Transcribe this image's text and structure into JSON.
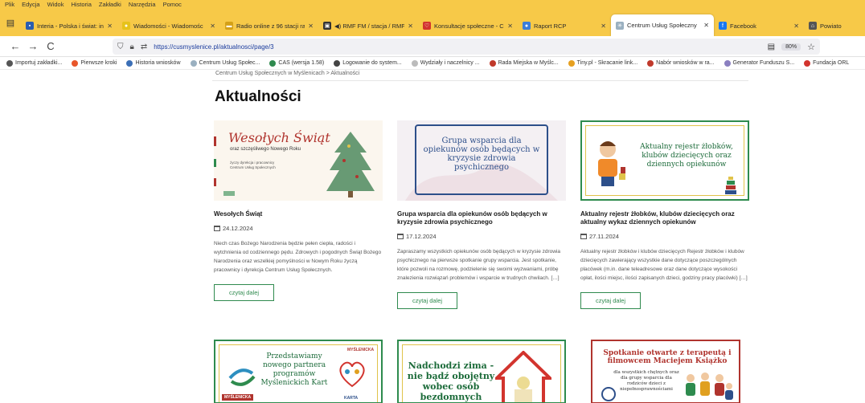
{
  "menu": [
    "Plik",
    "Edycja",
    "Widok",
    "Historia",
    "Zakładki",
    "Narzędzia",
    "Pomoc"
  ],
  "tabs": [
    {
      "title": "Interia - Polska i świat: info",
      "fav_color": "#2a5db0",
      "fav_glyph": "▪",
      "active": false
    },
    {
      "title": "Wiadomości - Wiadomośc",
      "fav_color": "#e6c21a",
      "fav_glyph": "●",
      "active": false
    },
    {
      "title": "Radio online z 96 stacji rad",
      "fav_color": "#d4a017",
      "fav_glyph": "▬",
      "active": false
    },
    {
      "title": "◀) RMF FM / stacja / RMF",
      "fav_color": "#333333",
      "fav_glyph": "▣",
      "active": false
    },
    {
      "title": "Konsultacje społeczne - Cl",
      "fav_color": "#d2342e",
      "fav_glyph": "♡",
      "active": false
    },
    {
      "title": "Raport RCP",
      "fav_color": "#3b7dd8",
      "fav_glyph": "●",
      "active": false
    },
    {
      "title": "Centrum Usług Społeczny",
      "fav_color": "#9ab0c0",
      "fav_glyph": "✳",
      "active": true
    },
    {
      "title": "Facebook",
      "fav_color": "#1877f2",
      "fav_glyph": "f",
      "active": false
    },
    {
      "title": "Powiato",
      "fav_color": "#555555",
      "fav_glyph": "⌂",
      "active": false
    }
  ],
  "nav": {
    "url": "https://cusmyslenice.pl/aktualnosci/page/3",
    "zoom": "80%"
  },
  "bookmarks": [
    {
      "label": "Importuj zakładki...",
      "color": "#555555"
    },
    {
      "label": "Pierwsze kroki",
      "color": "#e8562a"
    },
    {
      "label": "Historia wniosków",
      "color": "#3b6fb6"
    },
    {
      "label": "Centrum Usług Społec...",
      "color": "#9ab0c0"
    },
    {
      "label": "CAS (wersja 1.58)",
      "color": "#2f8a4e"
    },
    {
      "label": "Logowanie do system...",
      "color": "#444444"
    },
    {
      "label": "Wydziały i naczelnicy ...",
      "color": "#bbbbbb"
    },
    {
      "label": "Rada Miejska w Myślc...",
      "color": "#c0392b"
    },
    {
      "label": "Tiny.pl - Skracanie link...",
      "color": "#e6a020"
    },
    {
      "label": "Nabór wniosków w ra...",
      "color": "#c0392b"
    },
    {
      "label": "Generator Funduszu S...",
      "color": "#8a7fc0"
    },
    {
      "label": "Fundacja ORL",
      "color": "#d2342e"
    }
  ],
  "page": {
    "breadcrumb": "Centrum Usług Społecznych w Myślenicach > Aktualności",
    "title": "Aktualności",
    "read_more": "czytaj dalej"
  },
  "cards": [
    {
      "title": "Wesołych Świąt",
      "date": "24.12.2024",
      "text": "Niech czas Bożego Narodzenia będzie pełen ciepła, radości i wytchnienia od codziennego pędu. Zdrowych i pogodnych Świąt Bożego Narodzenia oraz wszelkiej pomyślności w Nowym Roku życzą pracownicy i dyrekcja Centrum Usług Społecznych.",
      "thumb": {
        "line1": "Wesołych Świąt",
        "line2": "oraz szczęśliwego Nowego Roku",
        "line3": "życzy dyrekcja i pracownicy Centrum Usług Społecznych"
      }
    },
    {
      "title": "Grupa wsparcia dla opiekunów osób będących w kryzysie zdrowia psychicznego",
      "date": "17.12.2024",
      "text": "Zapraszamy wszystkich opiekunów osób będących w kryzysie zdrowia psychicznego na pierwsze spotkanie grupy wsparcia. Jest spotkanie, które pozwoli na rozmowę, podzielenie się swoimi wyzwaniami, próbę znalezienia rozwiązań problemów i wsparcie w trudnych chwilach. […]",
      "thumb": {
        "line1": "Grupa wsparcia dla opiekunów osób będących w kryzysie zdrowia psychicznego"
      }
    },
    {
      "title": "Aktualny rejestr żłobków, klubów dziecięcych oraz aktualny wykaz dziennych opiekunów",
      "date": "27.11.2024",
      "text": "Aktualny rejestr żłobków i klubów dziecięcych Rejestr żłobków i klubów dziecięcych zawierający wszystkie dane dotyczące poszczególnych placówek (m.in. dane teleadresowe oraz dane dotyczące wysokości opłat, ilości miejsc, ilości zapisanych dzieci, godziny pracy placówki) […]",
      "thumb": {
        "line1": "Aktualny rejestr żłobków, klubów dziecięcych oraz dziennych opiekunów"
      }
    }
  ],
  "bottom_cards": [
    {
      "line1": "Przedstawiamy nowego partnera programów Myślenickich Kart",
      "tag1": "MYŚLENICKA",
      "tag2": "KARTA",
      "tag3": "MYŚLENICKA"
    },
    {
      "line1": "Nadchodzi zima - nie bądź obojętny wobec osób bezdomnych"
    },
    {
      "line1": "Spotkanie otwarte z terapeutą i filmowcem Maciejem Książko",
      "line2": "dla wszystkich chętnych oraz dla grupy wsparcia dla rodziców dzieci z niepełnosprawnościami"
    }
  ]
}
